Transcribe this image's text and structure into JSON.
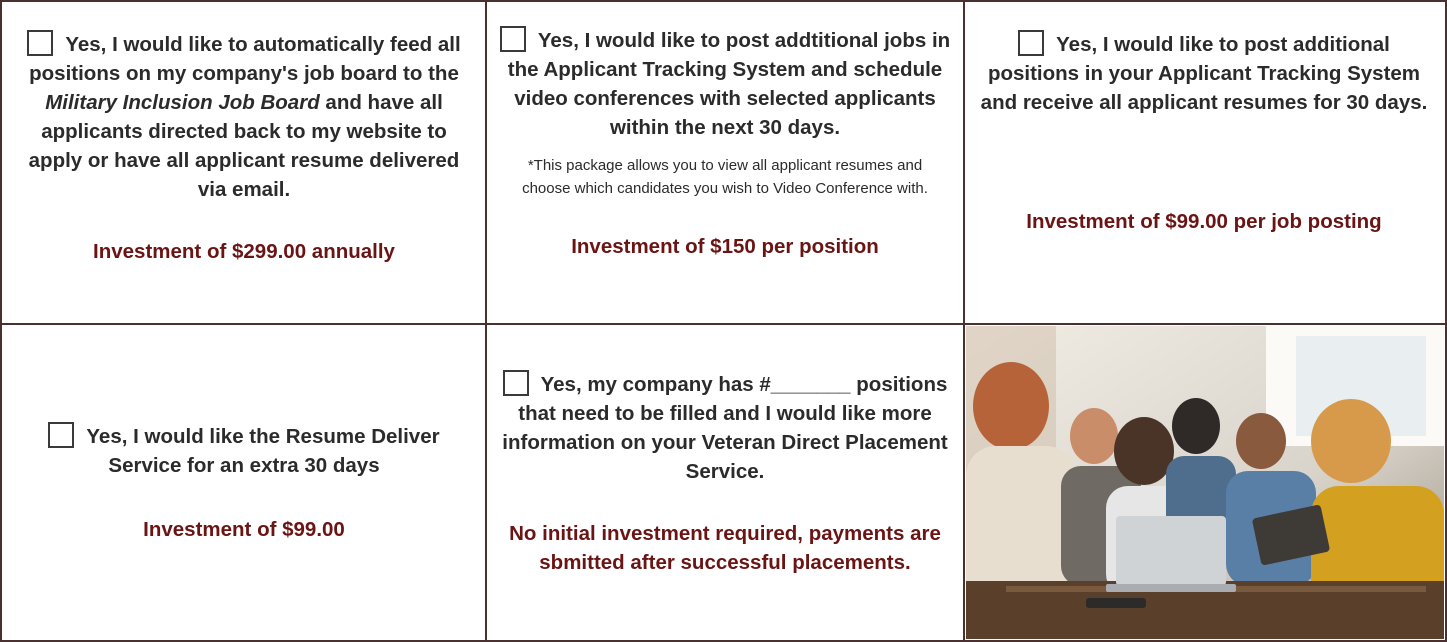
{
  "cells": {
    "c1": {
      "text_a": "Yes, I would like to automatically feed all positions on my company's job board to the ",
      "text_italic": "Military Inclusion Job Board",
      "text_b": " and have all applicants directed back to my website to apply or have all applicant resume delivered via email.",
      "price": "Investment of $299.00 annually"
    },
    "c2": {
      "text": "Yes, I would like to post addtitional jobs in the Applicant Tracking System and schedule video conferences with selected applicants within the next 30 days.",
      "note": "*This package allows you to view all applicant resumes and choose which candidates you wish to Video Conference with.",
      "price": "Investment of $150 per position"
    },
    "c3": {
      "text": "Yes, I would like to post additional positions in your Applicant Tracking System and receive all applicant resumes for 30 days.",
      "price": "Investment of $99.00 per job posting"
    },
    "c4": {
      "text": "Yes, I would like the Resume Deliver Service for an extra 30 days",
      "price": "Investment of $99.00"
    },
    "c5": {
      "text": "Yes, my company has #_______ positions that need to be filled and I would like more information on your Veteran Direct Placement Service.",
      "price": "No initial investment required, payments are sbmitted after successful placements."
    }
  },
  "colors": {
    "border": "#4a3030",
    "price": "#6b1414",
    "text": "#2b2b2b"
  },
  "image": {
    "subject": "group of people working around a laptop and tablet at a table"
  }
}
